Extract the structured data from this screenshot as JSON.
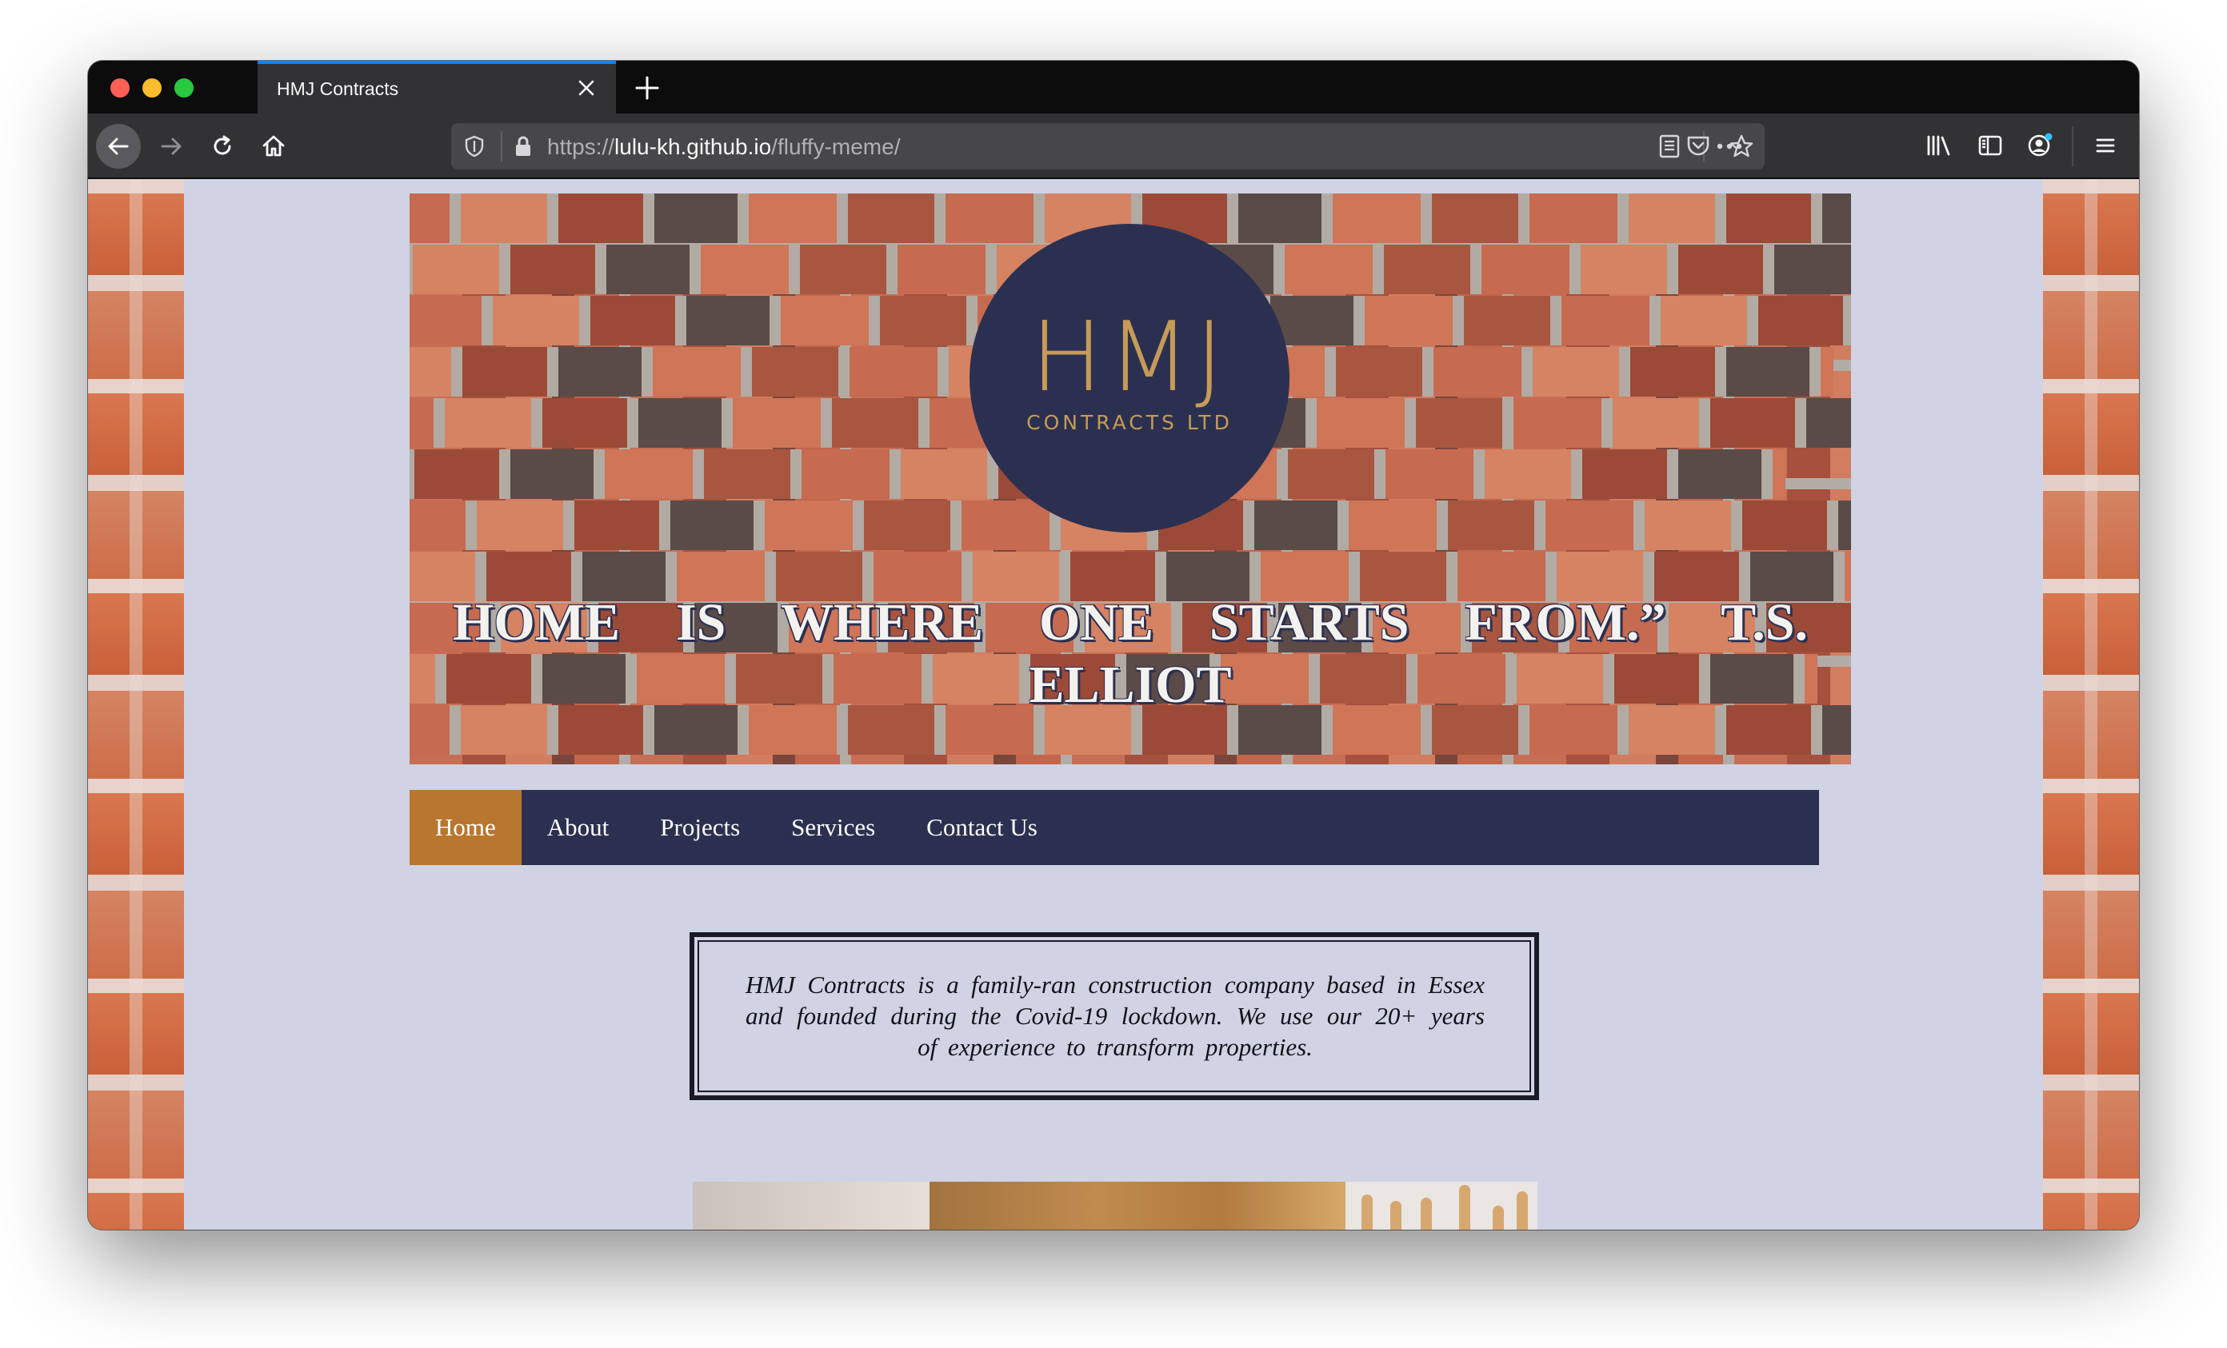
{
  "browser": {
    "tab_title": "HMJ Contracts",
    "url_prefix": "https://",
    "url_host": "lulu-kh.github.io",
    "url_path": "/fluffy-meme/"
  },
  "hero": {
    "logo_main": "HMJ",
    "logo_sub": "CONTRACTS LTD",
    "quote": "HOME IS WHERE ONE STARTS FROM.” T.S. ELLIOT"
  },
  "nav": {
    "items": [
      {
        "label": "Home",
        "active": true
      },
      {
        "label": "About",
        "active": false
      },
      {
        "label": "Projects",
        "active": false
      },
      {
        "label": "Services",
        "active": false
      },
      {
        "label": "Contact Us",
        "active": false
      }
    ]
  },
  "intro": {
    "text": "HMJ Contracts is a family-ran construction company based in Essex and founded during the Covid-19 lockdown. We use our 20+ years of experience to transform properties."
  },
  "colors": {
    "nav_bg": "#2c3050",
    "nav_active": "#b8762f",
    "page_bg": "#d0d3e3",
    "logo_gold": "#c59b57"
  },
  "icons": [
    "back-arrow-icon",
    "forward-arrow-icon",
    "reload-icon",
    "home-icon",
    "shield-icon",
    "lock-icon",
    "reader-view-icon",
    "more-icon",
    "pocket-icon",
    "bookmark-star-icon",
    "library-icon",
    "sidebar-icon",
    "account-icon",
    "hamburger-menu-icon",
    "close-icon",
    "plus-icon"
  ]
}
